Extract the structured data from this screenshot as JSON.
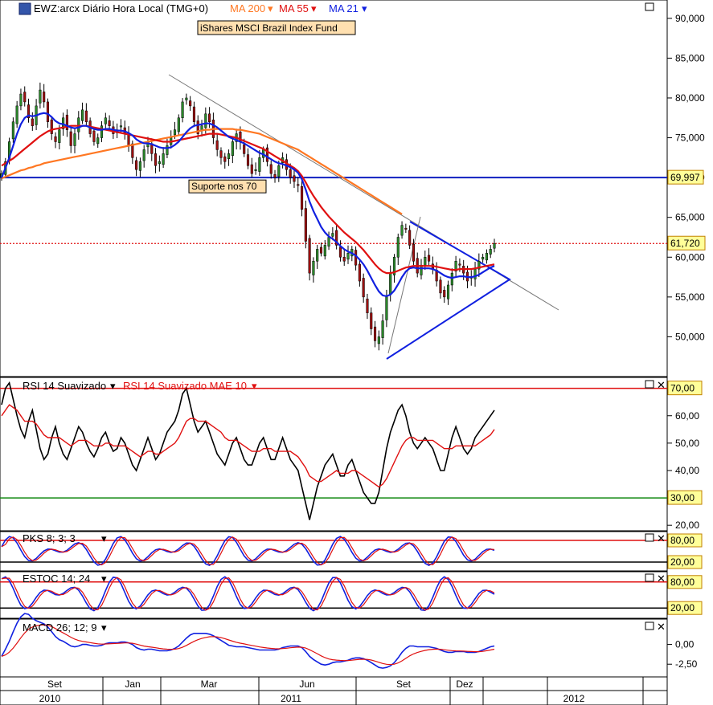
{
  "header": {
    "symbol": "EWZ:arcx Diário Hora Local (TMG+0)",
    "ma200": "MA 200",
    "ma55": "MA 55",
    "ma21": "MA 21",
    "fund_name": "iShares MSCI Brazil Index Fund",
    "support_label": "Suporte nos 70"
  },
  "colors": {
    "ma200": "#ff7722",
    "ma55": "#e01010",
    "ma21": "#1020e0",
    "support": "#1020c0",
    "price_tag": "#ffff99",
    "tag_border": "#c08000",
    "up": "#2a8a2a",
    "down": "#a01010"
  },
  "chart_data": [
    {
      "type": "candlestick",
      "title": "EWZ:arcx Diário Hora Local (TMG+0)",
      "ylim": [
        45000,
        92000
      ],
      "yticks": [
        "50,000",
        "55,000",
        "60,000",
        "65,000",
        "70,000",
        "75,000",
        "80,000",
        "85,000",
        "90,000"
      ],
      "ytick_values": [
        50000,
        55000,
        60000,
        65000,
        70000,
        75000,
        80000,
        85000,
        90000
      ],
      "support_level": 69997,
      "support_tag": "69,997",
      "last_price": 61720,
      "last_tag": "61,720",
      "close": [
        70500,
        72000,
        74500,
        77000,
        79000,
        80500,
        79500,
        77500,
        76500,
        79000,
        81000,
        79500,
        77000,
        75500,
        74500,
        76000,
        77500,
        76000,
        74000,
        75500,
        77500,
        78500,
        77000,
        75500,
        74500,
        75000,
        76500,
        77500,
        76500,
        75500,
        76000,
        76500,
        75500,
        74000,
        72500,
        71000,
        72000,
        73500,
        74500,
        73000,
        71500,
        72000,
        73000,
        74000,
        75000,
        76000,
        77500,
        79500,
        80000,
        79000,
        77000,
        75500,
        76500,
        78000,
        77000,
        75000,
        73500,
        72500,
        72000,
        73000,
        74500,
        75500,
        74500,
        73000,
        71500,
        70500,
        71000,
        72500,
        73500,
        72000,
        70500,
        70000,
        71500,
        72500,
        71000,
        70000,
        69500,
        69000,
        66000,
        62000,
        58000,
        59500,
        61000,
        60500,
        61500,
        62500,
        63000,
        61500,
        60000,
        59500,
        60500,
        61000,
        59000,
        57000,
        55000,
        53000,
        51000,
        49500,
        50000,
        52000,
        55000,
        58000,
        60000,
        62500,
        64000,
        63500,
        61500,
        59500,
        58000,
        59000,
        60000,
        59500,
        58500,
        57000,
        55500,
        55000,
        56500,
        58000,
        59500,
        59000,
        58000,
        57000,
        57500,
        58500,
        59500,
        60000,
        60500,
        61000,
        61720
      ],
      "ma21": [
        70000,
        71200,
        72500,
        74000,
        75500,
        76700,
        77500,
        77800,
        77700,
        77800,
        78000,
        78100,
        78000,
        77600,
        77100,
        76800,
        76700,
        76500,
        76300,
        76200,
        76300,
        76500,
        76500,
        76300,
        76100,
        76000,
        76000,
        76100,
        76100,
        76000,
        75900,
        75900,
        75800,
        75600,
        75300,
        74800,
        74500,
        74300,
        74300,
        74200,
        74000,
        73800,
        73700,
        73700,
        73800,
        74100,
        74500,
        75100,
        75700,
        76200,
        76500,
        76600,
        76700,
        76800,
        76800,
        76600,
        76300,
        75900,
        75500,
        75100,
        74900,
        74700,
        74500,
        74300,
        74000,
        73700,
        73400,
        73100,
        72900,
        72600,
        72300,
        72000,
        71800,
        71700,
        71500,
        71300,
        71000,
        70600,
        69800,
        68500,
        67000,
        65800,
        64800,
        63800,
        63100,
        62600,
        62300,
        61900,
        61400,
        61000,
        60700,
        60500,
        60200,
        59700,
        59100,
        58300,
        57400,
        56500,
        55700,
        55200,
        55100,
        55300,
        55800,
        56600,
        57500,
        58200,
        58600,
        58700,
        58600,
        58600,
        58600,
        58600,
        58500,
        58300,
        58000,
        57700,
        57500,
        57400,
        57500,
        57600,
        57600,
        57500,
        57500,
        57600,
        57800,
        58100,
        58400,
        58700,
        58900
      ],
      "ma55": [
        71500,
        71800,
        72100,
        72400,
        72800,
        73200,
        73600,
        74000,
        74400,
        74800,
        75200,
        75500,
        75800,
        76000,
        76100,
        76200,
        76300,
        76400,
        76500,
        76500,
        76500,
        76500,
        76500,
        76400,
        76300,
        76200,
        76100,
        76000,
        75900,
        75800,
        75700,
        75600,
        75500,
        75400,
        75300,
        75200,
        75100,
        75000,
        74900,
        74800,
        74700,
        74600,
        74500,
        74500,
        74500,
        74600,
        74700,
        74800,
        74900,
        75000,
        75100,
        75200,
        75300,
        75400,
        75500,
        75500,
        75500,
        75400,
        75300,
        75200,
        75100,
        75000,
        74800,
        74600,
        74400,
        74200,
        74000,
        73800,
        73600,
        73300,
        73000,
        72700,
        72400,
        72100,
        71800,
        71500,
        71200,
        70800,
        70200,
        69400,
        68500,
        67700,
        67000,
        66300,
        65700,
        65100,
        64600,
        64100,
        63600,
        63100,
        62700,
        62300,
        61900,
        61400,
        60900,
        60300,
        59700,
        59100,
        58600,
        58200,
        58000,
        58000,
        58100,
        58300,
        58500,
        58700,
        58800,
        58900,
        58900,
        58900,
        58900,
        58900,
        58900,
        58800,
        58700,
        58600,
        58500,
        58400,
        58400,
        58500,
        58500,
        58500,
        58500,
        58600,
        58700,
        58800,
        58900,
        59000,
        59100
      ],
      "ma200": [
        69900,
        70100,
        70300,
        70500,
        70700,
        70900,
        71000,
        71200,
        71300,
        71500,
        71600,
        71800,
        71900,
        72000,
        72100,
        72200,
        72300,
        72400,
        72500,
        72600,
        72700,
        72800,
        72900,
        73000,
        73100,
        73200,
        73300,
        73400,
        73500,
        73600,
        73700,
        73800,
        73900,
        74000,
        74100,
        74200,
        74300,
        74400,
        74500,
        74600,
        74700,
        74800,
        74900,
        75000,
        75100,
        75200,
        75300,
        75400,
        75500,
        75600,
        75700,
        75800,
        75900,
        76000,
        76000,
        76100,
        76100,
        76100,
        76100,
        76100,
        76100,
        76000,
        76000,
        75900,
        75800,
        75700,
        75600,
        75500,
        75300,
        75100,
        74900,
        74700,
        74500,
        74300,
        74100,
        73900,
        73700,
        73500,
        73200,
        72900,
        72600,
        72300,
        72000,
        71700,
        71400,
        71100,
        70800,
        70500,
        70200,
        69900,
        69600,
        69300,
        69000,
        68700,
        68400,
        68100,
        67800,
        67500,
        67200,
        66900,
        66600,
        66300,
        66000,
        65700,
        65400
      ]
    },
    {
      "type": "line",
      "title": "RSI 14 Suavizado",
      "series": [
        {
          "name": "RSI 14 Suavizado"
        },
        {
          "name": "RSI 14 Suavizado MAE 10"
        }
      ],
      "ylim": [
        18,
        74
      ],
      "yticks": [
        "20,00",
        "40,00",
        "50,00",
        "60,00"
      ],
      "ytick_values": [
        20,
        40,
        50,
        60
      ],
      "levels": [
        {
          "value": 70,
          "label": "70,00",
          "color": "#e01010"
        },
        {
          "value": 30,
          "label": "30,00",
          "color": "#118811"
        }
      ],
      "rsi": [
        64,
        70,
        72,
        66,
        60,
        55,
        52,
        58,
        62,
        55,
        48,
        44,
        46,
        52,
        56,
        50,
        46,
        44,
        48,
        52,
        56,
        54,
        50,
        47,
        45,
        48,
        52,
        54,
        50,
        47,
        48,
        52,
        50,
        46,
        42,
        40,
        44,
        48,
        52,
        48,
        44,
        46,
        50,
        54,
        56,
        58,
        62,
        68,
        70,
        64,
        58,
        54,
        56,
        58,
        54,
        50,
        46,
        44,
        42,
        46,
        50,
        52,
        48,
        44,
        42,
        42,
        46,
        50,
        52,
        48,
        44,
        44,
        48,
        52,
        48,
        44,
        42,
        40,
        34,
        28,
        22,
        28,
        34,
        38,
        42,
        44,
        46,
        42,
        38,
        38,
        42,
        44,
        40,
        36,
        32,
        30,
        28,
        28,
        32,
        40,
        48,
        54,
        58,
        62,
        64,
        60,
        54,
        50,
        48,
        50,
        52,
        50,
        48,
        44,
        40,
        40,
        46,
        52,
        56,
        52,
        48,
        46,
        48,
        52,
        54,
        56,
        58,
        60,
        62
      ],
      "rsi_ema": [
        60,
        62,
        64,
        63,
        62,
        60,
        58,
        58,
        58,
        57,
        55,
        53,
        52,
        52,
        52,
        52,
        51,
        50,
        49,
        50,
        51,
        51,
        51,
        50,
        49,
        49,
        49,
        50,
        50,
        49,
        49,
        49,
        49,
        48,
        47,
        46,
        45,
        46,
        47,
        47,
        46,
        46,
        47,
        48,
        49,
        50,
        52,
        55,
        58,
        59,
        59,
        58,
        58,
        58,
        57,
        56,
        55,
        54,
        52,
        51,
        51,
        51,
        50,
        49,
        48,
        47,
        47,
        47,
        48,
        48,
        48,
        47,
        47,
        47,
        47,
        47,
        46,
        45,
        43,
        41,
        38,
        37,
        36,
        36,
        37,
        38,
        39,
        40,
        39,
        39,
        39,
        40,
        40,
        39,
        38,
        37,
        36,
        35,
        34,
        35,
        37,
        40,
        43,
        46,
        49,
        51,
        52,
        52,
        51,
        51,
        51,
        51,
        51,
        50,
        49,
        48,
        48,
        48,
        49,
        49,
        49,
        49,
        49,
        49,
        50,
        51,
        52,
        53,
        55
      ]
    },
    {
      "type": "line",
      "title": "PKS 8; 3; 3",
      "ylim": [
        0,
        100
      ],
      "levels": [
        {
          "value": 80,
          "label": "80,00"
        },
        {
          "value": 20,
          "label": "20,00"
        }
      ]
    },
    {
      "type": "line",
      "title": "ESTOC 14; 24",
      "ylim": [
        0,
        100
      ],
      "levels": [
        {
          "value": 80,
          "label": "80,00"
        },
        {
          "value": 20,
          "label": "20,00"
        }
      ]
    },
    {
      "type": "line",
      "title": "MACD 26; 12; 9",
      "ylim": [
        -4,
        3
      ],
      "yticks": [
        "0,00",
        "-2,50"
      ],
      "ytick_values": [
        0,
        -2.5
      ]
    }
  ],
  "xaxis": {
    "months": [
      "Set",
      "Jan",
      "Mar",
      "Jun",
      "Set",
      "Dez"
    ],
    "years": [
      "2010",
      "2011",
      "2012"
    ]
  }
}
